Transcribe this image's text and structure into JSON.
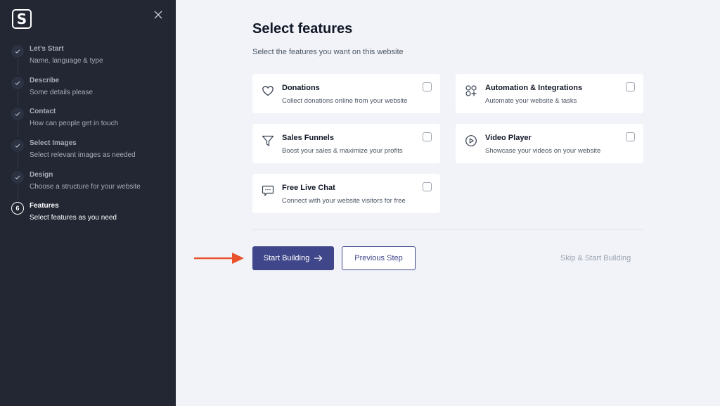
{
  "sidebar": {
    "logo_letter": "S",
    "steps": [
      {
        "title": "Let’s Start",
        "desc": "Name, language & type",
        "status": "done"
      },
      {
        "title": "Describe",
        "desc": "Some details please",
        "status": "done"
      },
      {
        "title": "Contact",
        "desc": "How can people get in touch",
        "status": "done"
      },
      {
        "title": "Select Images",
        "desc": "Select relevant images as needed",
        "status": "done"
      },
      {
        "title": "Design",
        "desc": "Choose a structure for your website",
        "status": "done"
      },
      {
        "title": "Features",
        "desc": "Select features as you need",
        "status": "active",
        "number": "6"
      }
    ]
  },
  "main": {
    "title": "Select features",
    "subtitle": "Select the features you want on this website",
    "features": [
      {
        "title": "Donations",
        "desc": "Collect donations online from your website",
        "icon": "heart-icon",
        "checked": false
      },
      {
        "title": "Automation & Integrations",
        "desc": "Automate your website & tasks",
        "icon": "apps-add-icon",
        "checked": false
      },
      {
        "title": "Sales Funnels",
        "desc": "Boost your sales & maximize your profits",
        "icon": "funnel-icon",
        "checked": false
      },
      {
        "title": "Video Player",
        "desc": "Showcase your videos on your website",
        "icon": "play-circle-icon",
        "checked": false
      },
      {
        "title": "Free Live Chat",
        "desc": "Connect with your website visitors for free",
        "icon": "chat-icon",
        "checked": false
      }
    ]
  },
  "actions": {
    "start_label": "Start Building",
    "previous_label": "Previous Step",
    "skip_label": "Skip & Start Building"
  },
  "colors": {
    "sidebar_bg": "#222733",
    "accent": "#3f4689",
    "arrow": "#e8512a"
  }
}
